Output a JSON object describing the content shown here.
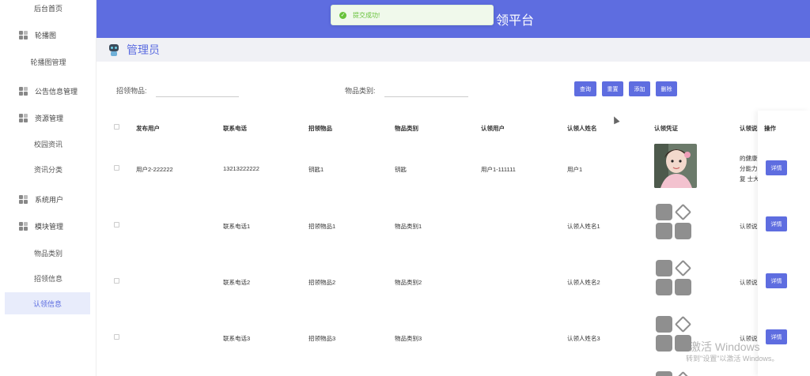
{
  "sidebar": {
    "home": "后台首页",
    "groups": [
      {
        "label": "轮播图"
      },
      {
        "label": "公告信息管理"
      },
      {
        "label": "资源管理"
      },
      {
        "label": "系统用户"
      },
      {
        "label": "模块管理"
      }
    ],
    "subs": {
      "carousel_mgmt": "轮播图管理",
      "campus_news": "校园资讯",
      "news_category": "资讯分类",
      "item_category": "物品类别",
      "claim_info": "招领信息",
      "recognize_info": "认领信息"
    }
  },
  "header": {
    "title_partial": "领平台",
    "toast": "提交成功!",
    "admin": "管理员"
  },
  "search": {
    "item_label": "招领物品:",
    "category_label": "物品类别:"
  },
  "buttons": {
    "query": "查询",
    "reset": "重置",
    "add": "添加",
    "delete": "删除"
  },
  "table": {
    "columns": [
      "发布用户",
      "联系电话",
      "招领物品",
      "物品类别",
      "认领用户",
      "认领人姓名",
      "认领凭证",
      "认领说明",
      "操作"
    ],
    "rows": [
      {
        "publisher": "用户2-222222",
        "phone": "13213222222",
        "item": "钥匙1",
        "category": "钥匙",
        "claim_user": "用户1-111111",
        "claimant": "用户1",
        "desc_lines": [
          "的健康?",
          "分能力,",
          "复 士大"
        ],
        "detail": "详情"
      },
      {
        "publisher": "",
        "phone": "联系电话1",
        "item": "招领物品1",
        "category": "物品类别1",
        "claim_user": "",
        "claimant": "认领人姓名1",
        "desc_lines": [
          "认领说明"
        ],
        "detail": "详情"
      },
      {
        "publisher": "",
        "phone": "联系电话2",
        "item": "招领物品2",
        "category": "物品类别2",
        "claim_user": "",
        "claimant": "认领人姓名2",
        "desc_lines": [
          "认领说明"
        ],
        "detail": "详情"
      },
      {
        "publisher": "",
        "phone": "联系电话3",
        "item": "招领物品3",
        "category": "物品类别3",
        "claim_user": "",
        "claimant": "认领人姓名3",
        "desc_lines": [
          "认领说明"
        ],
        "detail": "详情"
      }
    ]
  },
  "watermark": {
    "line1": "激活 Windows",
    "line2": "转到\"设置\"以激活 Windows。"
  },
  "colors": {
    "primary": "#5e6de0",
    "success": "#67c23a"
  }
}
